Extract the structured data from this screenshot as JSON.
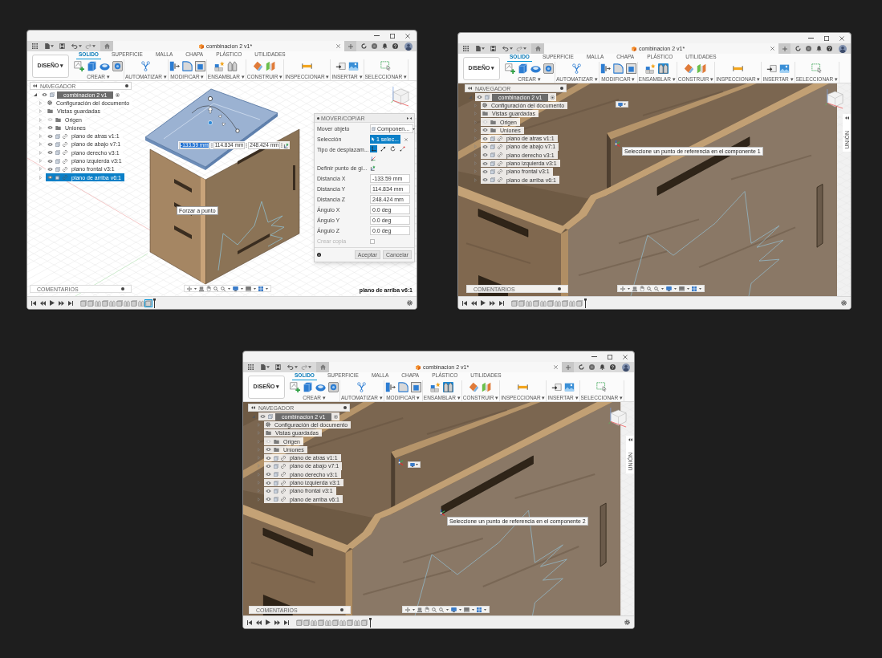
{
  "windows": [
    {
      "document_tab": {
        "title": "combinacion 2 v1*"
      },
      "workspace_menu": "DISEÑO ▾",
      "ribbon_tabs": [
        {
          "label": "SOLIDO",
          "selected": true
        },
        {
          "label": "SUPERFICIE",
          "selected": false
        },
        {
          "label": "MALLA",
          "selected": false
        },
        {
          "label": "CHAPA",
          "selected": false
        },
        {
          "label": "PLÁSTICO",
          "selected": false
        },
        {
          "label": "UTILIDADES",
          "selected": false
        }
      ],
      "tool_groups": [
        {
          "label": "CREAR ▾",
          "tools": [
            {
              "kind": "sketch",
              "active": false
            },
            {
              "kind": "extrude",
              "active": false
            },
            {
              "kind": "revolve",
              "active": false
            },
            {
              "kind": "hole",
              "active": false
            }
          ]
        },
        {
          "label": "AUTOMATIZAR ▾",
          "tools": [
            {
              "kind": "automate",
              "active": false
            }
          ]
        },
        {
          "label": "MODIFICAR ▾",
          "tools": [
            {
              "kind": "presspull",
              "active": false
            },
            {
              "kind": "fillet",
              "active": false
            },
            {
              "kind": "shell",
              "active": false
            }
          ]
        },
        {
          "label": "ENSAMBLAR ▾",
          "tools": [
            {
              "kind": "component",
              "active": false
            },
            {
              "kind": "joint",
              "active": false
            }
          ]
        },
        {
          "label": "CONSTRUIR ▾",
          "tools": [
            {
              "kind": "plane",
              "active": false
            },
            {
              "kind": "midplane",
              "active": false
            }
          ]
        },
        {
          "label": "INSPECCIONAR ▾",
          "tools": [
            {
              "kind": "measure",
              "active": false
            }
          ]
        },
        {
          "label": "INSERTAR ▾",
          "tools": [
            {
              "kind": "insert",
              "active": false
            },
            {
              "kind": "image",
              "active": false
            }
          ]
        },
        {
          "label": "SELECCIONAR ▾",
          "tools": [
            {
              "kind": "select",
              "active": false
            }
          ]
        }
      ],
      "navigator": {
        "title": "NAVEGADOR",
        "tree": [
          {
            "kind": "root",
            "label": "combinacion 2 v1",
            "expanded": true,
            "visible": true,
            "selected": false,
            "children": [
              {
                "kind": "settings",
                "label": "Configuración del documento",
                "expanded": false,
                "selected": false
              },
              {
                "kind": "views",
                "label": "Vistas guardadas",
                "expanded": false,
                "selected": false
              },
              {
                "kind": "folder",
                "label": "Origen",
                "expanded": false,
                "visible": false,
                "selected": false
              },
              {
                "kind": "folder",
                "label": "Uniones",
                "expanded": false,
                "visible": true,
                "selected": false
              },
              {
                "kind": "component",
                "label": "plano de atras v1:1",
                "expanded": false,
                "visible": true,
                "selected": false
              },
              {
                "kind": "component",
                "label": "plano de abajo v7:1",
                "expanded": false,
                "visible": true,
                "selected": false
              },
              {
                "kind": "component",
                "label": "plano derecho v3:1",
                "expanded": false,
                "visible": true,
                "selected": false
              },
              {
                "kind": "component",
                "label": "plano izquierda v3:1",
                "expanded": false,
                "visible": true,
                "selected": false
              },
              {
                "kind": "component",
                "label": "plano frontal v3:1",
                "expanded": false,
                "visible": true,
                "selected": false
              },
              {
                "kind": "component",
                "label": "plano de arriba v6:1",
                "expanded": false,
                "visible": true,
                "selected": true
              }
            ]
          }
        ]
      },
      "viewport": {
        "kind": "overview",
        "snap_tooltip": "Forzar a punto",
        "dimension_inputs": [
          {
            "value": "-133.59 mm",
            "selected": true
          },
          {
            "value": "114.834 mm",
            "selected": false
          },
          {
            "value": "248.424 mm",
            "selected": false
          }
        ],
        "status_text": "plano de arriba v6:1"
      },
      "move_dialog": {
        "title": "MOVER/COPIAR",
        "fields": [
          {
            "kind": "dropdown",
            "label": "Mover objeto",
            "value": "Componen..."
          },
          {
            "kind": "selection",
            "label": "Selección",
            "value": "1 selec..."
          },
          {
            "kind": "move_type",
            "label": "Tipo de desplazam...",
            "options": [
              {
                "kind": "free",
                "selected": true
              },
              {
                "kind": "translate",
                "selected": false
              },
              {
                "kind": "rotate",
                "selected": false
              },
              {
                "kind": "point",
                "selected": false
              },
              {
                "kind": "position",
                "selected": false
              }
            ]
          },
          {
            "kind": "pick",
            "label": "Definir punto de gi..."
          },
          {
            "kind": "input",
            "label": "Distancia X",
            "value": "-133.59 mm"
          },
          {
            "kind": "input",
            "label": "Distancia Y",
            "value": "114.834 mm"
          },
          {
            "kind": "input",
            "label": "Distancia Z",
            "value": "248.424 mm"
          },
          {
            "kind": "input",
            "label": "Ángulo X",
            "value": "0.0 deg"
          },
          {
            "kind": "input",
            "label": "Ángulo Y",
            "value": "0.0 deg"
          },
          {
            "kind": "input",
            "label": "Ángulo Z",
            "value": "0.0 deg"
          },
          {
            "kind": "checkbox",
            "label": "Crear copia",
            "checked": false,
            "disabled": true
          }
        ],
        "buttons": [
          "Aceptar",
          "Cancelar"
        ]
      },
      "comments_panel": {
        "title": "COMENTARIOS"
      },
      "timeline": {
        "features": [
          {
            "kind": "component",
            "selected": false
          },
          {
            "kind": "component",
            "selected": false
          },
          {
            "kind": "joint",
            "selected": false
          },
          {
            "kind": "component",
            "selected": false
          },
          {
            "kind": "joint",
            "selected": false
          },
          {
            "kind": "component",
            "selected": false
          },
          {
            "kind": "joint",
            "selected": false
          },
          {
            "kind": "component",
            "selected": false
          },
          {
            "kind": "joint",
            "selected": false
          },
          {
            "kind": "component",
            "selected": true
          }
        ]
      }
    },
    {
      "document_tab": {
        "title": "combinacion 2 v1*"
      },
      "workspace_menu": "DISEÑO ▾",
      "ribbon_tabs": [
        {
          "label": "SOLIDO",
          "selected": true
        },
        {
          "label": "SUPERFICIE",
          "selected": false
        },
        {
          "label": "MALLA",
          "selected": false
        },
        {
          "label": "CHAPA",
          "selected": false
        },
        {
          "label": "PLÁSTICO",
          "selected": false
        },
        {
          "label": "UTILIDADES",
          "selected": false
        }
      ],
      "tool_groups": [
        {
          "label": "CREAR ▾",
          "tools": [
            {
              "kind": "sketch",
              "active": false
            },
            {
              "kind": "extrude",
              "active": false
            },
            {
              "kind": "revolve",
              "active": false
            },
            {
              "kind": "hole",
              "active": false
            }
          ]
        },
        {
          "label": "AUTOMATIZAR ▾",
          "tools": [
            {
              "kind": "automate",
              "active": false
            }
          ]
        },
        {
          "label": "MODIFICAR ▾",
          "tools": [
            {
              "kind": "presspull",
              "active": false
            },
            {
              "kind": "fillet",
              "active": false
            },
            {
              "kind": "shell",
              "active": false
            }
          ]
        },
        {
          "label": "ENSAMBLAR ▾",
          "tools": [
            {
              "kind": "component",
              "active": false
            },
            {
              "kind": "joint",
              "active": true
            }
          ]
        },
        {
          "label": "CONSTRUIR ▾",
          "tools": [
            {
              "kind": "plane",
              "active": false
            },
            {
              "kind": "midplane",
              "active": false
            }
          ]
        },
        {
          "label": "INSPECCIONAR ▾",
          "tools": [
            {
              "kind": "measure",
              "active": false
            }
          ]
        },
        {
          "label": "INSERTAR ▾",
          "tools": [
            {
              "kind": "insert",
              "active": false
            },
            {
              "kind": "image",
              "active": false
            }
          ]
        },
        {
          "label": "SELECCIONAR ▾",
          "tools": [
            {
              "kind": "select",
              "active": false
            }
          ]
        }
      ],
      "navigator": {
        "title": "NAVEGADOR",
        "tree": [
          {
            "kind": "root",
            "label": "combinacion 2 v1",
            "expanded": true,
            "visible": true,
            "selected": false,
            "children": [
              {
                "kind": "settings",
                "label": "Configuración del documento",
                "expanded": false,
                "selected": false
              },
              {
                "kind": "views",
                "label": "Vistas guardadas",
                "expanded": false,
                "selected": false
              },
              {
                "kind": "folder",
                "label": "Origen",
                "expanded": false,
                "visible": false,
                "selected": false
              },
              {
                "kind": "folder",
                "label": "Uniones",
                "expanded": false,
                "visible": true,
                "selected": false
              },
              {
                "kind": "component",
                "label": "plano de atras v1:1",
                "expanded": false,
                "visible": true,
                "selected": false
              },
              {
                "kind": "component",
                "label": "plano de abajo v7:1",
                "expanded": false,
                "visible": true,
                "selected": false
              },
              {
                "kind": "component",
                "label": "plano derecho v3:1",
                "expanded": false,
                "visible": true,
                "selected": false
              },
              {
                "kind": "component",
                "label": "plano izquierda v3:1",
                "expanded": false,
                "visible": true,
                "selected": false
              },
              {
                "kind": "component",
                "label": "plano frontal v3:1",
                "expanded": false,
                "visible": true,
                "selected": false
              },
              {
                "kind": "component",
                "label": "plano de arriba v6:1",
                "expanded": false,
                "visible": true,
                "selected": false
              }
            ]
          }
        ]
      },
      "viewport": {
        "kind": "closeup",
        "prompt": "Seleccione un punto de referencia en el componente 1",
        "side_panel": {
          "label": "UNIÓN"
        }
      },
      "comments_panel": {
        "title": "COMENTARIOS"
      },
      "timeline": {
        "features": [
          {
            "kind": "component",
            "selected": false
          },
          {
            "kind": "component",
            "selected": false
          },
          {
            "kind": "joint",
            "selected": false
          },
          {
            "kind": "component",
            "selected": false
          },
          {
            "kind": "joint",
            "selected": false
          },
          {
            "kind": "component",
            "selected": false
          },
          {
            "kind": "joint",
            "selected": false
          },
          {
            "kind": "component",
            "selected": false
          },
          {
            "kind": "joint",
            "selected": false
          },
          {
            "kind": "component",
            "selected": false
          }
        ]
      }
    },
    {
      "document_tab": {
        "title": "combinacion 2 v1*"
      },
      "workspace_menu": "DISEÑO ▾",
      "ribbon_tabs": [
        {
          "label": "SOLIDO",
          "selected": true
        },
        {
          "label": "SUPERFICIE",
          "selected": false
        },
        {
          "label": "MALLA",
          "selected": false
        },
        {
          "label": "CHAPA",
          "selected": false
        },
        {
          "label": "PLÁSTICO",
          "selected": false
        },
        {
          "label": "UTILIDADES",
          "selected": false
        }
      ],
      "tool_groups": [
        {
          "label": "CREAR ▾",
          "tools": [
            {
              "kind": "sketch",
              "active": false
            },
            {
              "kind": "extrude",
              "active": false
            },
            {
              "kind": "revolve",
              "active": false
            },
            {
              "kind": "hole",
              "active": false
            }
          ]
        },
        {
          "label": "AUTOMATIZAR ▾",
          "tools": [
            {
              "kind": "automate",
              "active": false
            }
          ]
        },
        {
          "label": "MODIFICAR ▾",
          "tools": [
            {
              "kind": "presspull",
              "active": false
            },
            {
              "kind": "fillet",
              "active": false
            },
            {
              "kind": "shell",
              "active": false
            }
          ]
        },
        {
          "label": "ENSAMBLAR ▾",
          "tools": [
            {
              "kind": "component",
              "active": false
            },
            {
              "kind": "joint",
              "active": true
            }
          ]
        },
        {
          "label": "CONSTRUIR ▾",
          "tools": [
            {
              "kind": "plane",
              "active": false
            },
            {
              "kind": "midplane",
              "active": false
            }
          ]
        },
        {
          "label": "INSPECCIONAR ▾",
          "tools": [
            {
              "kind": "measure",
              "active": false
            }
          ]
        },
        {
          "label": "INSERTAR ▾",
          "tools": [
            {
              "kind": "insert",
              "active": false
            },
            {
              "kind": "image",
              "active": false
            }
          ]
        },
        {
          "label": "SELECCIONAR ▾",
          "tools": [
            {
              "kind": "select",
              "active": false
            }
          ]
        }
      ],
      "navigator": {
        "title": "NAVEGADOR",
        "tree": [
          {
            "kind": "root",
            "label": "combinacion 2 v1",
            "expanded": true,
            "visible": true,
            "selected": false,
            "children": [
              {
                "kind": "settings",
                "label": "Configuración del documento",
                "expanded": false,
                "selected": false
              },
              {
                "kind": "views",
                "label": "Vistas guardadas",
                "expanded": false,
                "selected": false
              },
              {
                "kind": "folder",
                "label": "Origen",
                "expanded": false,
                "visible": false,
                "selected": false
              },
              {
                "kind": "folder",
                "label": "Uniones",
                "expanded": false,
                "visible": true,
                "selected": false
              },
              {
                "kind": "component",
                "label": "plano de atras v1:1",
                "expanded": false,
                "visible": true,
                "selected": false
              },
              {
                "kind": "component",
                "label": "plano de abajo v7:1",
                "expanded": false,
                "visible": true,
                "selected": false
              },
              {
                "kind": "component",
                "label": "plano derecho v3:1",
                "expanded": false,
                "visible": true,
                "selected": false
              },
              {
                "kind": "component",
                "label": "plano izquierda v3:1",
                "expanded": false,
                "visible": true,
                "selected": false
              },
              {
                "kind": "component",
                "label": "plano frontal v3:1",
                "expanded": false,
                "visible": true,
                "selected": false
              },
              {
                "kind": "component",
                "label": "plano de arriba v6:1",
                "expanded": false,
                "visible": true,
                "selected": false
              }
            ]
          }
        ]
      },
      "viewport": {
        "kind": "closeup",
        "prompt": "Seleccione un punto de referencia en el componente 2",
        "side_panel": {
          "label": "UNIÓN"
        }
      },
      "comments_panel": {
        "title": "COMENTARIOS"
      },
      "timeline": {
        "features": [
          {
            "kind": "component",
            "selected": false
          },
          {
            "kind": "component",
            "selected": false
          },
          {
            "kind": "joint",
            "selected": false
          },
          {
            "kind": "component",
            "selected": false
          },
          {
            "kind": "joint",
            "selected": false
          },
          {
            "kind": "component",
            "selected": false
          },
          {
            "kind": "joint",
            "selected": false
          },
          {
            "kind": "component",
            "selected": false
          },
          {
            "kind": "joint",
            "selected": false
          },
          {
            "kind": "component",
            "selected": false
          }
        ]
      }
    }
  ]
}
